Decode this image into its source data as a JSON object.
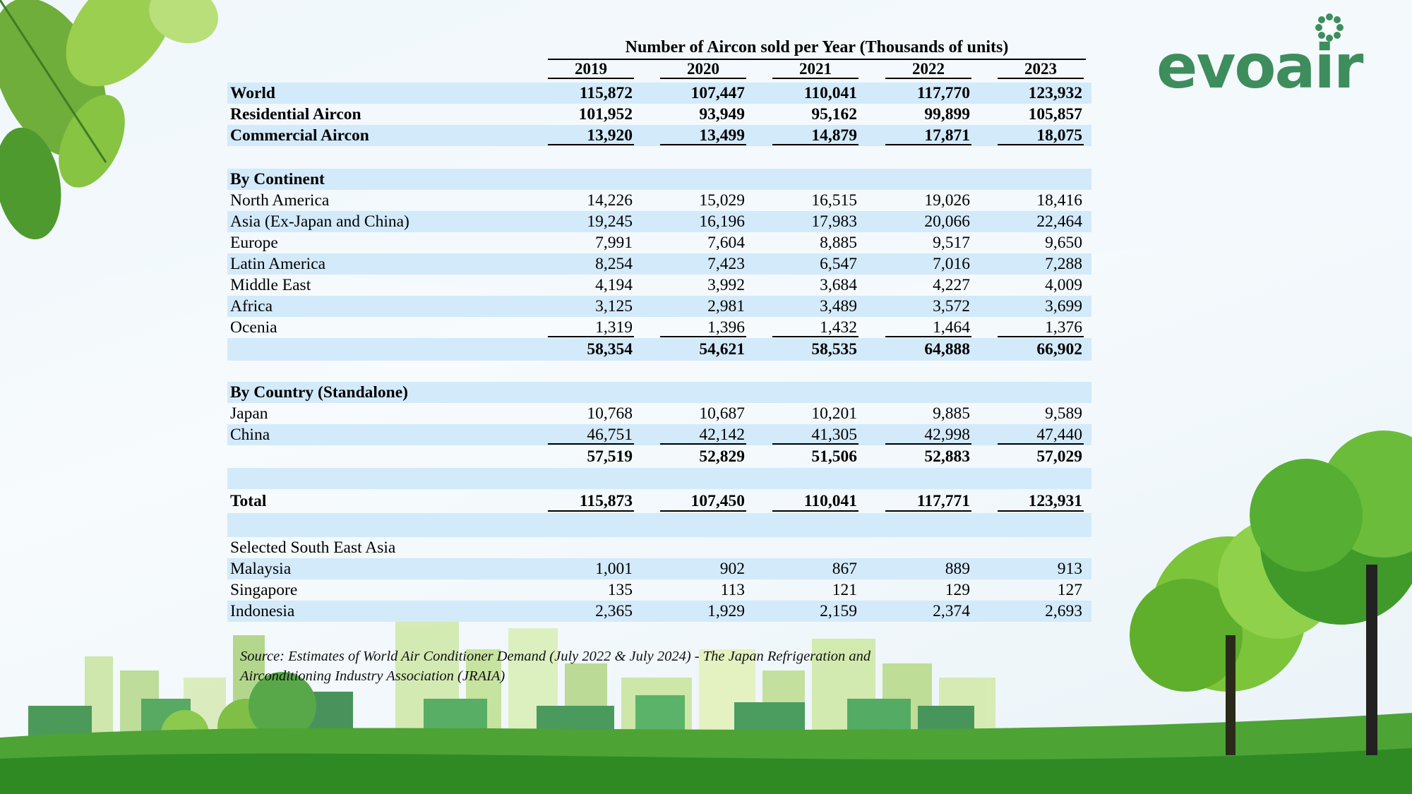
{
  "brand": {
    "logo_text": "evoair",
    "color": "#3e8d5c"
  },
  "table": {
    "title": "Number of Aircon sold per Year (Thousands of units)",
    "years": [
      "2019",
      "2020",
      "2021",
      "2022",
      "2023"
    ],
    "rows": [
      {
        "label": "World",
        "values": [
          "115,872",
          "107,447",
          "110,041",
          "117,770",
          "123,932"
        ]
      },
      {
        "label": "Residential Aircon",
        "values": [
          "101,952",
          "93,949",
          "95,162",
          "99,899",
          "105,857"
        ]
      },
      {
        "label": "Commercial Aircon",
        "values": [
          "13,920",
          "13,499",
          "14,879",
          "17,871",
          "18,075"
        ]
      },
      {
        "label": "",
        "values": [
          "",
          "",
          "",
          "",
          ""
        ]
      },
      {
        "label": "By Continent",
        "values": [
          "",
          "",
          "",
          "",
          ""
        ]
      },
      {
        "label": "North America",
        "values": [
          "14,226",
          "15,029",
          "16,515",
          "19,026",
          "18,416"
        ]
      },
      {
        "label": "Asia (Ex-Japan and China)",
        "values": [
          "19,245",
          "16,196",
          "17,983",
          "20,066",
          "22,464"
        ]
      },
      {
        "label": "Europe",
        "values": [
          "7,991",
          "7,604",
          "8,885",
          "9,517",
          "9,650"
        ]
      },
      {
        "label": "Latin America",
        "values": [
          "8,254",
          "7,423",
          "6,547",
          "7,016",
          "7,288"
        ]
      },
      {
        "label": "Middle East",
        "values": [
          "4,194",
          "3,992",
          "3,684",
          "4,227",
          "4,009"
        ]
      },
      {
        "label": "Africa",
        "values": [
          "3,125",
          "2,981",
          "3,489",
          "3,572",
          "3,699"
        ]
      },
      {
        "label": "Ocenia",
        "values": [
          "1,319",
          "1,396",
          "1,432",
          "1,464",
          "1,376"
        ]
      },
      {
        "label": "",
        "values": [
          "58,354",
          "54,621",
          "58,535",
          "64,888",
          "66,902"
        ]
      },
      {
        "label": "",
        "values": [
          "",
          "",
          "",
          "",
          ""
        ]
      },
      {
        "label": "By Country (Standalone)",
        "values": [
          "",
          "",
          "",
          "",
          ""
        ]
      },
      {
        "label": "Japan",
        "values": [
          "10,768",
          "10,687",
          "10,201",
          "9,885",
          "9,589"
        ]
      },
      {
        "label": "China",
        "values": [
          "46,751",
          "42,142",
          "41,305",
          "42,998",
          "47,440"
        ]
      },
      {
        "label": "",
        "values": [
          "57,519",
          "52,829",
          "51,506",
          "52,883",
          "57,029"
        ]
      },
      {
        "label": "",
        "values": [
          "",
          "",
          "",
          "",
          ""
        ]
      },
      {
        "label": "Total",
        "values": [
          "115,873",
          "107,450",
          "110,041",
          "117,771",
          "123,931"
        ]
      },
      {
        "label": "",
        "values": [
          "",
          "",
          "",
          "",
          ""
        ]
      },
      {
        "label": "Selected South East Asia",
        "values": [
          "",
          "",
          "",
          "",
          ""
        ]
      },
      {
        "label": "Malaysia",
        "values": [
          "1,001",
          "902",
          "867",
          "889",
          "913"
        ]
      },
      {
        "label": "Singapore",
        "values": [
          "135",
          "113",
          "121",
          "129",
          "127"
        ]
      },
      {
        "label": "Indonesia",
        "values": [
          "2,365",
          "1,929",
          "2,159",
          "2,374",
          "2,693"
        ]
      }
    ]
  },
  "source": "Source: Estimates of World Air Conditioner Demand (July 2022 & July 2024) - The Japan Refrigeration and Airconditioning Industry Association (JRAIA)"
}
